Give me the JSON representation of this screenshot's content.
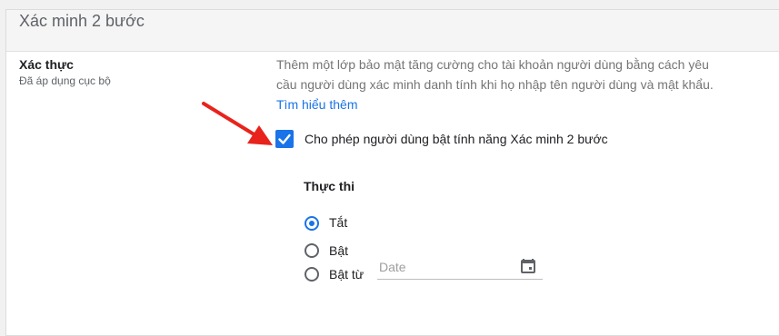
{
  "header": {
    "title": "Xác minh 2 bước"
  },
  "setting": {
    "title": "Xác thực",
    "subtitle": "Đã áp dụng cục bộ"
  },
  "description": {
    "text": "Thêm một lớp bảo mật tăng cường cho tài khoản người dùng bằng cách yêu cầu người dùng xác minh danh tính khi họ nhập tên người dùng và mật khẩu.",
    "link": "Tìm hiểu thêm"
  },
  "allow_2sv": {
    "label": "Cho phép người dùng bật tính năng Xác minh 2 bước",
    "checked": true
  },
  "enforcement": {
    "title": "Thực thi",
    "options": [
      {
        "label": "Tắt",
        "selected": true
      },
      {
        "label": "Bật",
        "selected": false
      },
      {
        "label": "Bật từ",
        "selected": false
      }
    ],
    "date_placeholder": "Date"
  },
  "colors": {
    "accent": "#1a73e8",
    "arrow": "#e8231c"
  },
  "icons": [
    "checkbox-checked-icon",
    "calendar-icon",
    "red-arrow"
  ]
}
